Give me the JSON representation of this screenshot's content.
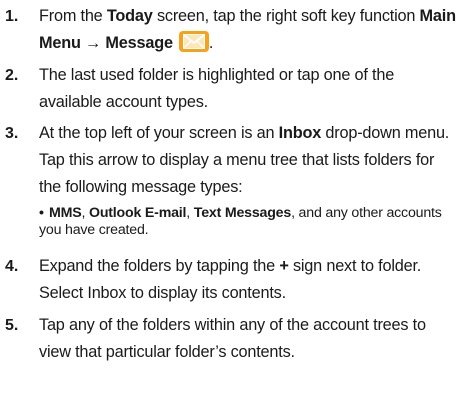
{
  "steps": [
    {
      "num": "1.",
      "line1_pre": "From the ",
      "line1_today": "Today",
      "line1_mid": " screen, tap the right soft key function ",
      "line1_main": "Main",
      "line2_menu": "Menu → Message",
      "line2_end": "."
    },
    {
      "num": "2.",
      "line1": "The last used folder is highlighted or tap one of the",
      "line2": "available account types."
    },
    {
      "num": "3.",
      "line1_pre": "At the top left of your screen is an ",
      "line1_inbox": "Inbox",
      "line1_post": " drop-down menu.",
      "line2": "Tap this arrow to display a menu tree that lists folders for",
      "line3": "the following message types:"
    },
    {
      "num": "4.",
      "line1_pre": "Expand the folders by tapping the ",
      "line1_plus": "+",
      "line1_post": " sign next to folder.",
      "line2": "Select Inbox to display its contents."
    },
    {
      "num": "5.",
      "line1": "Tap any of the folders within any of the account trees to",
      "line2": "view that particular folder’s contents."
    }
  ],
  "bullet": {
    "dot": "•",
    "mms": "MMS",
    "sep1": ", ",
    "outlook": "Outlook E-mail",
    "sep2": ", ",
    "text": "Text Messages",
    "tail": ", and any other accounts",
    "line2": "you have created."
  },
  "icons": {
    "message": "envelope-icon"
  },
  "colors": {
    "icon_bg": "#f7a31a"
  }
}
